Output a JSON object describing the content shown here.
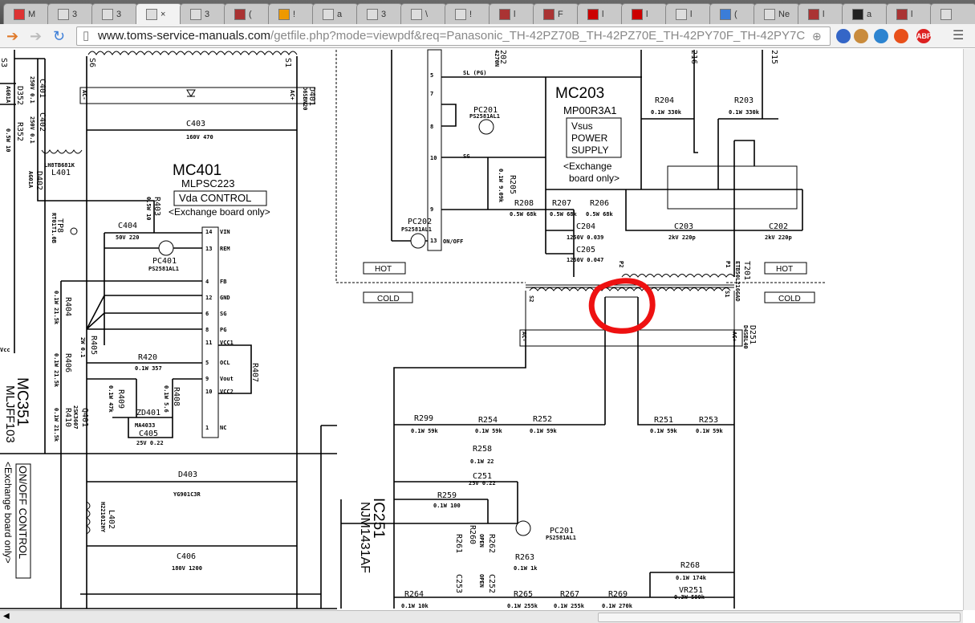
{
  "browser": {
    "tabs": [
      {
        "icon": "gmail-icon",
        "label": "M"
      },
      {
        "icon": "page-icon",
        "label": "3"
      },
      {
        "icon": "page-icon",
        "label": "3"
      },
      {
        "icon": "document-icon",
        "label": "×",
        "active": true
      },
      {
        "icon": "page-icon",
        "label": "3"
      },
      {
        "icon": "tv-icon",
        "label": "("
      },
      {
        "icon": "site-icon",
        "label": "!"
      },
      {
        "icon": "page-icon",
        "label": "a"
      },
      {
        "icon": "page-icon",
        "label": "3"
      },
      {
        "icon": "document-icon",
        "label": "\\"
      },
      {
        "icon": "hand-icon",
        "label": "!"
      },
      {
        "icon": "tv-icon",
        "label": "l"
      },
      {
        "icon": "tv-icon",
        "label": "F"
      },
      {
        "icon": "youtube-icon",
        "label": "l"
      },
      {
        "icon": "youtube-icon",
        "label": "l"
      },
      {
        "icon": "image-icon",
        "label": "l"
      },
      {
        "icon": "google-icon",
        "label": "("
      },
      {
        "icon": "text-icon",
        "label": "Ne"
      },
      {
        "icon": "tv-icon",
        "label": "l"
      },
      {
        "icon": "amazon-icon",
        "label": "a"
      },
      {
        "icon": "tv-icon",
        "label": "l"
      },
      {
        "icon": "misc-icon",
        "label": ""
      }
    ],
    "url_host": "www.toms-service-manuals.com",
    "url_path": "/getfile.php?mode=viewpdf&req=Panasonic_TH-42PZ70B_TH-42PZ70E_TH-42PY70F_TH-42PY7C",
    "extensions": [
      "ABP"
    ]
  },
  "schematic": {
    "mc401": {
      "name": "MC401",
      "part": "MLPSC223",
      "box": "Vda CONTROL",
      "note": "<Exchange board only>"
    },
    "mc203": {
      "name": "MC203",
      "part": "MP00R3A1",
      "box1": "Vsus",
      "box2": "POWER",
      "box3": "SUPPLY",
      "note1": "<Exchange",
      "note2": "board only>"
    },
    "mc351": {
      "name": "MC351",
      "part": "MLJFF103",
      "box": "ON/OFF CONTROL",
      "note": "<Exchange board only>"
    },
    "ic251": {
      "name": "IC251",
      "part": "NJM1431AF"
    },
    "zones": {
      "hot": "HOT",
      "cold": "COLD"
    },
    "pins401": [
      {
        "n": "14",
        "l": "VIN"
      },
      {
        "n": "13",
        "l": "REM"
      },
      {
        "n": "4",
        "l": "FB"
      },
      {
        "n": "12",
        "l": "GND"
      },
      {
        "n": "6",
        "l": "SG"
      },
      {
        "n": "8",
        "l": "PG"
      },
      {
        "n": "11",
        "l": "VCC1"
      },
      {
        "n": "5",
        "l": "OCL"
      },
      {
        "n": "9",
        "l": "Vout"
      },
      {
        "n": "10",
        "l": "VCC2"
      },
      {
        "n": "1",
        "l": "NC"
      }
    ],
    "pins203": [
      {
        "n": "5",
        "l": "SL (PG)"
      },
      {
        "n": "7",
        "l": ""
      },
      {
        "n": "8",
        "l": ""
      },
      {
        "n": "10",
        "l": "SG"
      },
      {
        "n": "9",
        "l": ""
      },
      {
        "n": "13",
        "l": "ON/OFF"
      }
    ],
    "parts": {
      "c401": "C401",
      "c401v": "250V 0.1",
      "c402": "C402",
      "c402v": "250V 0.1",
      "d352": "D352",
      "d352v": "AG01A",
      "r352": "R352",
      "r352v": "0.5W 10",
      "l401": "L401",
      "l401v": "LH8TB681K",
      "d402": "D402",
      "d402v": "AG01A",
      "c403": "C403",
      "c403v": "160V 470",
      "d401": "D401",
      "d401v": "D6SBN20",
      "r403": "R403",
      "r403v": "0.5W 10",
      "c404": "C404",
      "c404v": "50V 220",
      "tp8": "TP8",
      "tp8v": "RT01T1.0B",
      "pc401": "PC401",
      "pc401v": "PS2581AL1",
      "r404": "R404",
      "r404v": "0.1W 21.5k",
      "r405": "R405",
      "r405v": "2W 0.1",
      "r406": "R406",
      "r406v": "0.1W 21.5k",
      "r410": "R410",
      "r410v": "0.1W 21.5k",
      "r420": "R420",
      "r420v": "0.1W 357",
      "r409": "R409",
      "r409v": "0.1W 47k",
      "r408": "R408",
      "r408v": "0.1W 5.6",
      "r407": "R407",
      "zd401": "ZD401",
      "zd401v": "MA4033",
      "c405": "C405",
      "c405v": "25V 0.22",
      "q401": "Q401",
      "q401v": "2SK3607",
      "d403": "D403",
      "d403v": "YG901C3R",
      "l402": "L402",
      "l402v": "H221012HY",
      "c406": "C406",
      "c406v": "180V 1200",
      "pc201": "PC201",
      "pc201v": "PS2581AL1",
      "pc202": "PC202",
      "pc202v": "PS2581AL1",
      "r205": "R205",
      "r205v": "0.1W 9.09k",
      "r208": "R208",
      "r208v": "0.5W 68k",
      "r207": "R207",
      "r207v": "0.5W 68k",
      "r206": "R206",
      "r206v": "0.5W 68k",
      "c204": "C204",
      "c204v": "1250V 0.039",
      "c205": "C205",
      "c205v": "1250V 0.047",
      "r204": "R204",
      "r204v": "0.1W 330k",
      "r203": "R203",
      "r203v": "0.1W 330k",
      "c203": "C203",
      "c203v": "2kV 220p",
      "c202": "C202",
      "c202v": "2kV 220p",
      "t201": "T201",
      "t201v": "ETB50L216GAD",
      "d251": "D251",
      "d251v": "D4SBL40",
      "r299": "R299",
      "r254": "R254",
      "r252": "R252",
      "r251": "R251",
      "r253": "R253",
      "v59k": "0.1W 59k",
      "r258": "R258",
      "r258v": "0.1W 22",
      "c251": "C251",
      "c251v": "25V 0.22",
      "r259": "R259",
      "r259v": "0.1W 100",
      "r260": "R260",
      "r261": "R261",
      "r262": "R262",
      "c253": "C253",
      "c252": "C252",
      "open": "OPEN",
      "r263": "R263",
      "r263v": "0.1W 1k",
      "r264": "R264",
      "r264v": "0.1W 10k",
      "r265": "R265",
      "r265v": "0.1W 255k",
      "r267": "R267",
      "r267v": "0.1W 255k",
      "r269": "R269",
      "r269v": "0.1W 270k",
      "r268": "R268",
      "r268v": "0.1W 174k",
      "vr251": "VR251",
      "vr251v": "0.3W 500k",
      "r216": "216",
      "r215": "215",
      "d202": "202",
      "d202v": "4270N",
      "acm": "AC-",
      "acp": "AC+",
      "s1": "S1",
      "s2": "S2",
      "s3": "S3",
      "s6": "S6",
      "p1": "P1",
      "p2": "P2",
      "vcc": "Vcc"
    }
  },
  "colors": {
    "highlight": "#ee1111"
  }
}
